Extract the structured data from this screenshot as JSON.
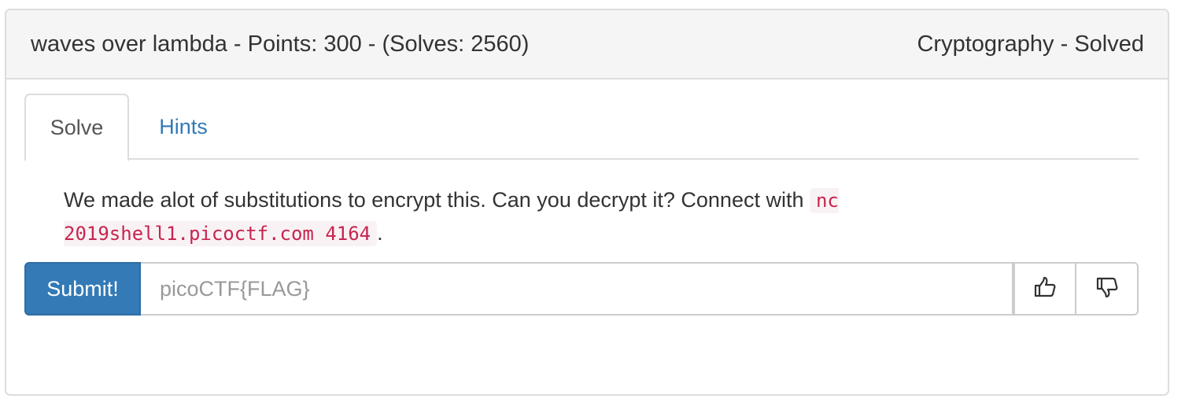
{
  "header": {
    "title": "waves over lambda - Points: 300 - (Solves: 2560)",
    "status": "Cryptography - Solved"
  },
  "tabs": [
    {
      "label": "Solve",
      "active": true
    },
    {
      "label": "Hints",
      "active": false
    }
  ],
  "description": {
    "text": "We made alot of substitutions to encrypt this. Can you decrypt it? Connect with ",
    "command": "nc 2019shell1.picoctf.com 4164",
    "suffix": "."
  },
  "form": {
    "submit_label": "Submit!",
    "flag_placeholder": "picoCTF{FLAG}",
    "flag_value": ""
  },
  "icons": {
    "upvote": "thumbs-up-icon",
    "downvote": "thumbs-down-icon"
  },
  "colors": {
    "primary": "#337ab7",
    "code_text": "#c7254e",
    "code_bg": "#f9f2f4"
  }
}
